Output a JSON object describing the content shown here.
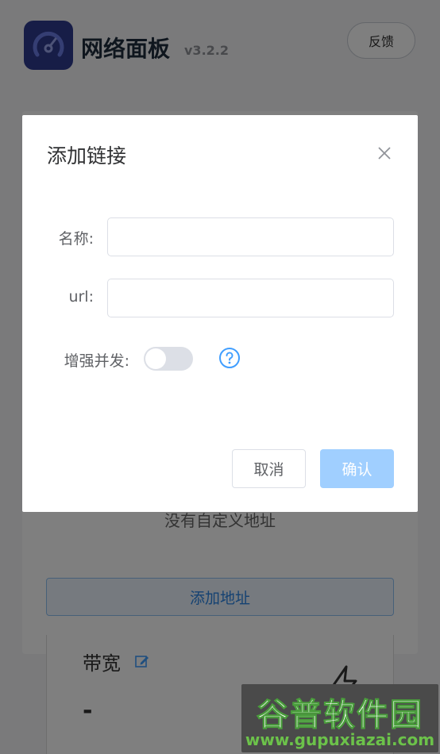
{
  "app": {
    "title": "网络面板",
    "version": "v3.2.2",
    "feedback_label": "反馈",
    "logo_icon": "speedometer-icon",
    "brand_color": "#2f3a8f"
  },
  "background": {
    "empty_text": "没有自定义地址",
    "add_address_label": "添加地址",
    "bandwidth_label": "带宽",
    "bandwidth_value": "-",
    "edit_icon": "edit-icon",
    "bolt_icon": "lightning-icon"
  },
  "dialog": {
    "title": "添加链接",
    "close_icon": "close-icon",
    "fields": {
      "name_label": "名称:",
      "name_value": "",
      "url_label": "url:",
      "url_value": ""
    },
    "enhance": {
      "label": "增强并发:",
      "enabled": false,
      "help_icon": "question-circle-icon"
    },
    "buttons": {
      "cancel_label": "取消",
      "confirm_label": "确认"
    },
    "accent_color": "#409eff",
    "confirm_disabled_color": "#a0cfff"
  },
  "watermark": {
    "title": "谷普软件园",
    "url": "www.gupuxiazai.com"
  }
}
